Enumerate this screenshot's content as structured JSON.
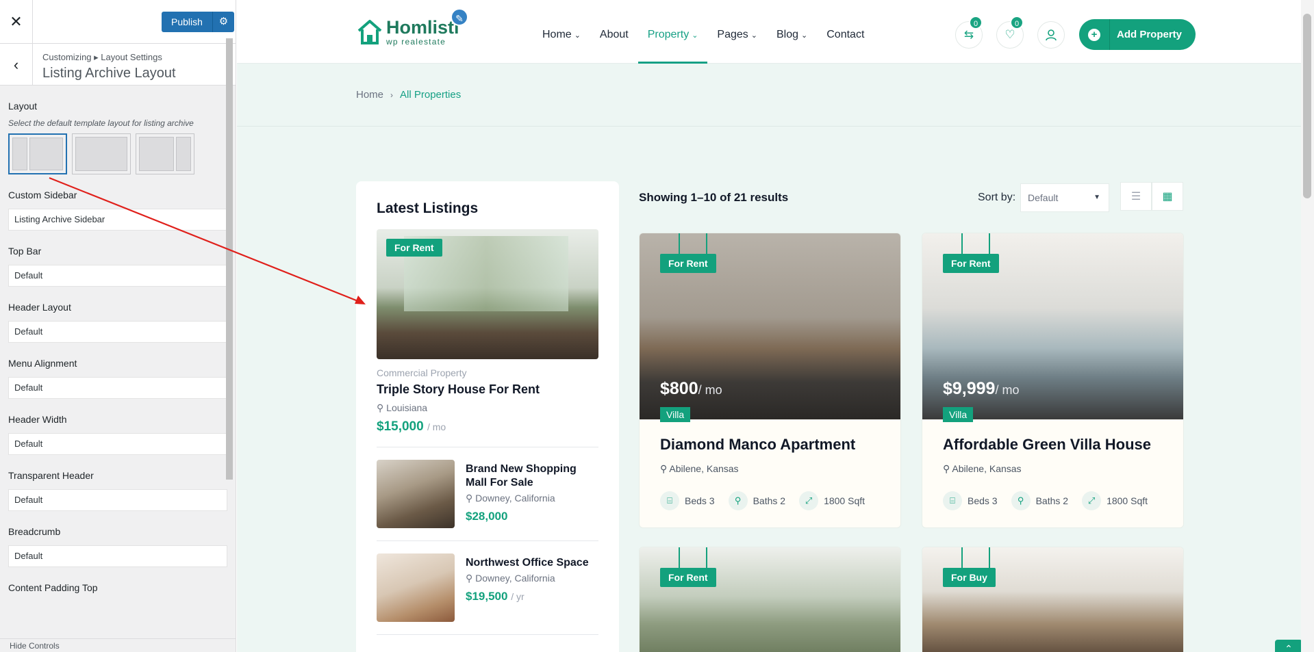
{
  "customizer": {
    "close_icon": "close-icon",
    "publish_label": "Publish",
    "gear_icon": "gear-icon",
    "back_icon": "chevron-left-icon",
    "breadcrumb": "Customizing ▸ Layout Settings",
    "heading": "Listing Archive Layout",
    "layout_label": "Layout",
    "layout_desc": "Select the default template layout for listing archive",
    "fields": [
      {
        "label": "Custom Sidebar",
        "value": "Listing Archive Sidebar"
      },
      {
        "label": "Top Bar",
        "value": "Default"
      },
      {
        "label": "Header Layout",
        "value": "Default"
      },
      {
        "label": "Menu Alignment",
        "value": "Default"
      },
      {
        "label": "Header Width",
        "value": "Default"
      },
      {
        "label": "Transparent Header",
        "value": "Default"
      },
      {
        "label": "Breadcrumb",
        "value": "Default"
      }
    ],
    "next_label": "Content Padding Top",
    "footer_label": "Hide Controls"
  },
  "header": {
    "logo_name": "Homlisti",
    "logo_sub": "wp realestate",
    "nav": [
      {
        "label": "Home",
        "dropdown": true
      },
      {
        "label": "About",
        "dropdown": false
      },
      {
        "label": "Property",
        "dropdown": true,
        "active": true
      },
      {
        "label": "Pages",
        "dropdown": true
      },
      {
        "label": "Blog",
        "dropdown": true
      },
      {
        "label": "Contact",
        "dropdown": false
      }
    ],
    "compare_count": "0",
    "wishlist_count": "0",
    "add_property_label": "Add Property"
  },
  "breadcrumb": {
    "home": "Home",
    "current": "All Properties"
  },
  "widget": {
    "title": "Latest Listings",
    "featured": {
      "badge": "For Rent",
      "category": "Commercial Property",
      "title": "Triple Story House For Rent",
      "location": "Louisiana",
      "price": "$15,000",
      "unit": "/ mo"
    },
    "items": [
      {
        "title": "Brand New Shopping Mall For Sale",
        "location": "Downey, California",
        "price": "$28,000",
        "unit": ""
      },
      {
        "title": "Northwest Office Space",
        "location": "Downey, California",
        "price": "$19,500",
        "unit": "/ yr"
      }
    ]
  },
  "results": {
    "text": "Showing 1–10 of 21 results",
    "sort_label": "Sort by:",
    "sort_value": "Default"
  },
  "cards": [
    {
      "tag": "For Rent",
      "price": "$800",
      "unit": "/ mo",
      "type": "Villa",
      "title": "Diamond Manco Apartment",
      "location": "Abilene, Kansas",
      "beds": "Beds 3",
      "baths": "Baths 2",
      "area": "1800 Sqft"
    },
    {
      "tag": "For Rent",
      "price": "$9,999",
      "unit": "/ mo",
      "type": "Villa",
      "title": "Affordable Green Villa House",
      "location": "Abilene, Kansas",
      "beds": "Beds 3",
      "baths": "Baths 2",
      "area": "1800 Sqft"
    },
    {
      "tag": "For Rent"
    },
    {
      "tag": "For Buy"
    }
  ],
  "colors": {
    "accent": "#13a17d",
    "annotation_arrow": "#e0201b",
    "wp_blue": "#2271b1"
  }
}
